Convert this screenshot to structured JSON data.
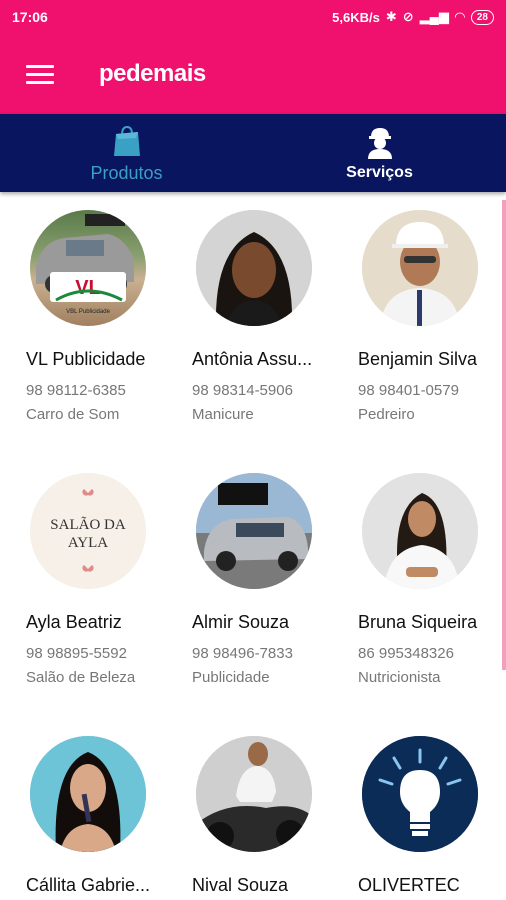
{
  "status_bar": {
    "time": "17:06",
    "network_speed": "5,6KB/s",
    "battery": "28"
  },
  "app_bar": {
    "title": "pedemais"
  },
  "tabs": [
    {
      "label": "Produtos",
      "icon": "shopping-bag-icon"
    },
    {
      "label": "Serviços",
      "icon": "worker-icon"
    }
  ],
  "providers": [
    {
      "name": "VL Publicidade",
      "phone": "98 98112-6385",
      "category": "Carro de Som",
      "logo_text": "VL",
      "logo_caption": "VBL Publicidade"
    },
    {
      "name": "Antônia Assu...",
      "phone": "98 98314-5906",
      "category": "Manicure"
    },
    {
      "name": "Benjamin Silva",
      "phone": "98 98401-0579",
      "category": "Pedreiro"
    },
    {
      "name": "Ayla Beatriz",
      "phone": "98 98895-5592",
      "category": "Salão de Beleza",
      "logo_text": "SALÃO DA AYLA"
    },
    {
      "name": "Almir Souza",
      "phone": "98 98496-7833",
      "category": "Publicidade"
    },
    {
      "name": "Bruna Siqueira",
      "phone": "86 995348326",
      "category": "Nutricionista"
    },
    {
      "name": "Cállita Gabrie...",
      "phone": "",
      "category": ""
    },
    {
      "name": "Nival Souza",
      "phone": "",
      "category": ""
    },
    {
      "name": "OLIVERTEC",
      "phone": "",
      "category": ""
    }
  ]
}
